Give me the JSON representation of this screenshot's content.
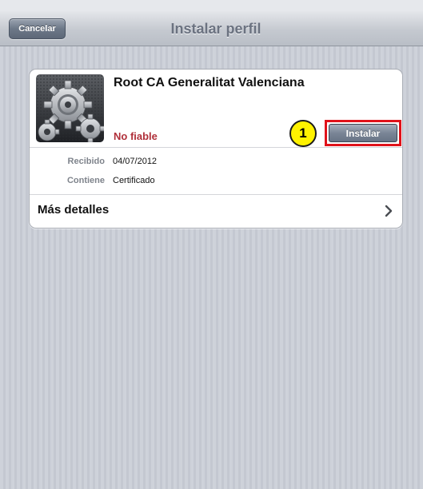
{
  "navbar": {
    "cancel_label": "Cancelar",
    "title": "Instalar perfil"
  },
  "profile": {
    "name": "Root CA Generalitat Valenciana",
    "trust_status": "No fiable",
    "install_label": "Instalar",
    "icon": "settings-gears-icon"
  },
  "callout": {
    "number": "1",
    "color": "#e0121a",
    "badge_color": "#fff200"
  },
  "details": [
    {
      "label": "Recibido",
      "value": "04/07/2012"
    },
    {
      "label": "Contiene",
      "value": "Certificado"
    }
  ],
  "more_details": {
    "label": "Más detalles",
    "icon": "chevron-right-icon"
  },
  "colors": {
    "untrusted": "#b0303a",
    "background": "#c9cdd6"
  }
}
